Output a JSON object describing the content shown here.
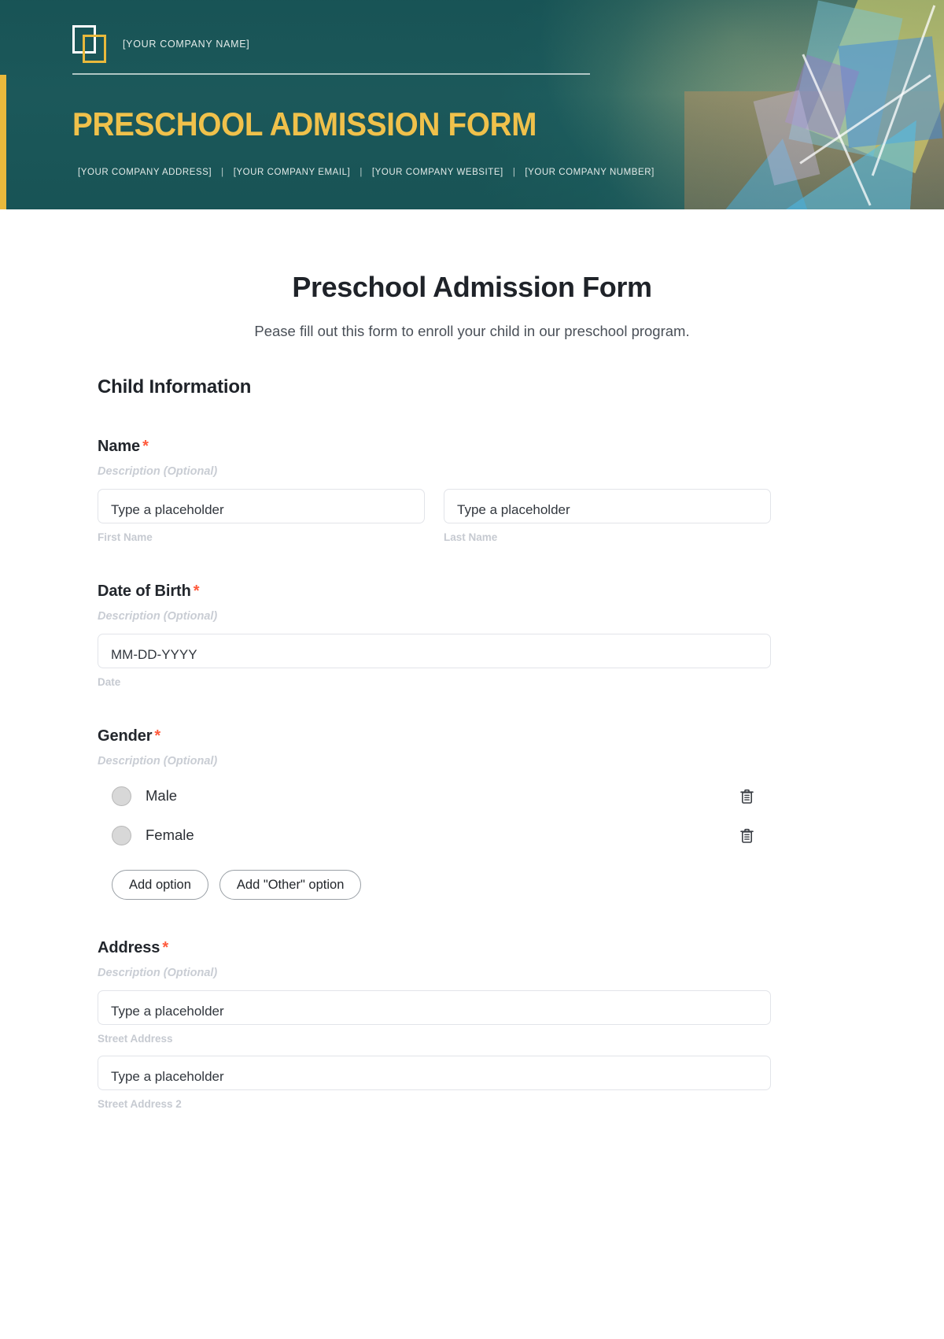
{
  "banner": {
    "company_name": "[YOUR COMPANY NAME]",
    "title": "PRESCHOOL ADMISSION FORM",
    "contact": {
      "address": "[YOUR COMPANY ADDRESS]",
      "email": "[YOUR COMPANY EMAIL]",
      "website": "[YOUR COMPANY WEBSITE]",
      "number": "[YOUR COMPANY NUMBER]",
      "separator": "|"
    },
    "colors": {
      "background": "#1d5a5c",
      "accent_gold": "#e9b93c",
      "title_gold": "#f0c14b"
    }
  },
  "form": {
    "title": "Preschool Admission Form",
    "subtitle": "Pease fill out this form to enroll your child in our preschool program.",
    "section_heading": "Child Information",
    "required_marker": "*",
    "description_placeholder": "Description (Optional)",
    "fields": {
      "name": {
        "label": "Name",
        "description": "Description (Optional)",
        "first": {
          "placeholder": "Type a placeholder",
          "sub_label": "First Name"
        },
        "last": {
          "placeholder": "Type a placeholder",
          "sub_label": "Last Name"
        }
      },
      "dob": {
        "label": "Date of Birth",
        "description": "Description (Optional)",
        "placeholder": "MM-DD-YYYY",
        "sub_label": "Date"
      },
      "gender": {
        "label": "Gender",
        "description": "Description (Optional)",
        "options": [
          {
            "label": "Male",
            "delete_icon": "trash-icon"
          },
          {
            "label": "Female",
            "delete_icon": "trash-icon"
          }
        ],
        "add_option_label": "Add option",
        "add_other_option_label": "Add \"Other\" option"
      },
      "address": {
        "label": "Address",
        "description": "Description (Optional)",
        "street1": {
          "placeholder": "Type a placeholder",
          "sub_label": "Street Address"
        },
        "street2": {
          "placeholder": "Type a placeholder",
          "sub_label": "Street Address 2"
        }
      }
    }
  }
}
